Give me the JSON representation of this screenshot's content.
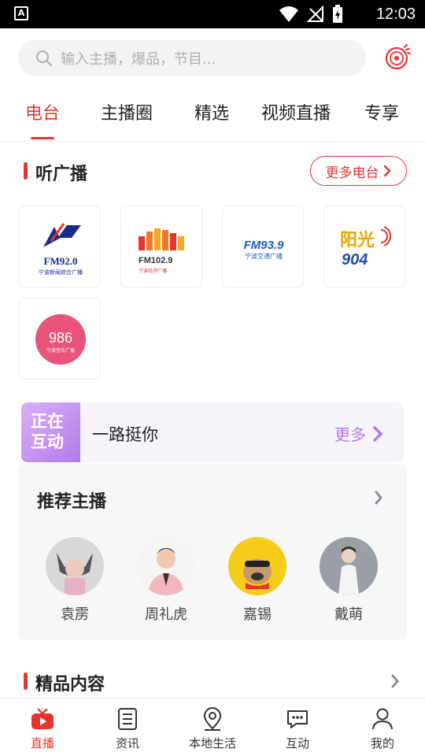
{
  "status_bar": {
    "time": "12:03"
  },
  "search": {
    "placeholder": "输入主播，爆品，节目..."
  },
  "tabs": [
    {
      "label": "电台",
      "active": true
    },
    {
      "label": "主播圈",
      "active": false
    },
    {
      "label": "精选",
      "active": false
    },
    {
      "label": "视频直播",
      "active": false
    },
    {
      "label": "专享",
      "active": false
    }
  ],
  "listen_section": {
    "title": "听广播",
    "more_label": "更多电台"
  },
  "stations": [
    {
      "freq": "FM92.0",
      "subtitle": "宁波新闻综合广播",
      "color": "#1a2b8c"
    },
    {
      "freq": "FM102.9",
      "subtitle": "宁波经济广播",
      "color": "#e8342e"
    },
    {
      "freq": "FM93.9",
      "subtitle": "宁波交通广播",
      "color": "#1e5bc6"
    },
    {
      "freq": "904",
      "brand": "阳光",
      "color": "#e8a400"
    },
    {
      "freq": "986",
      "subtitle": "宁波音乐广播",
      "color": "#e8547a"
    }
  ],
  "live_interaction": {
    "badge_line1": "正在",
    "badge_line2": "互动",
    "title": "一路挺你",
    "more_label": "更多"
  },
  "hosts_section": {
    "title": "推荐主播",
    "hosts": [
      {
        "name": "袁雳"
      },
      {
        "name": "周礼虎"
      },
      {
        "name": "嘉锡"
      },
      {
        "name": "戴萌"
      }
    ]
  },
  "premium_section": {
    "title": "精品内容"
  },
  "bottom_nav": [
    {
      "label": "直播",
      "active": true
    },
    {
      "label": "资讯",
      "active": false
    },
    {
      "label": "本地生活",
      "active": false
    },
    {
      "label": "互动",
      "active": false
    },
    {
      "label": "我的",
      "active": false
    }
  ],
  "colors": {
    "accent": "#e8342e",
    "purple": "#b27ae8"
  }
}
